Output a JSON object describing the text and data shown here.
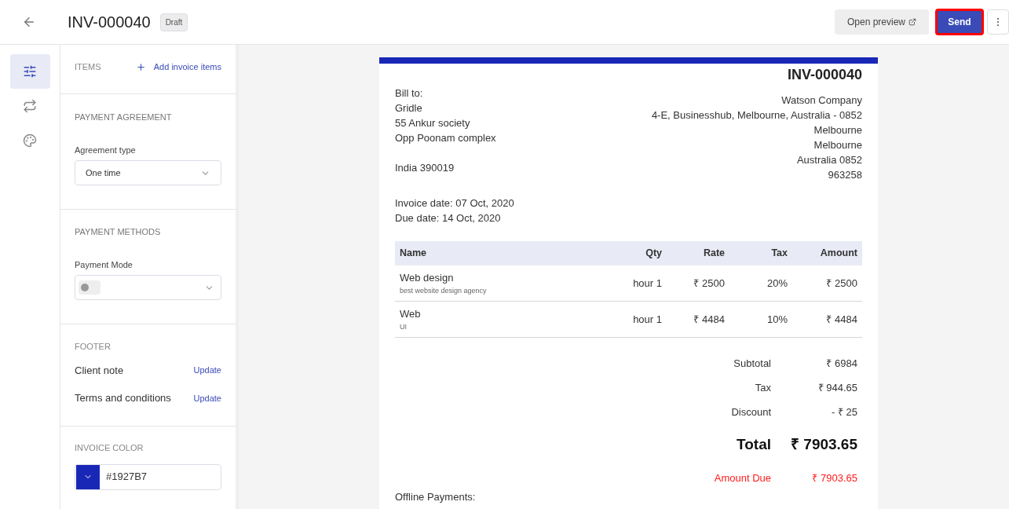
{
  "header": {
    "title": "INV-000040",
    "status": "Draft",
    "preview_button": "Open preview",
    "send_button": {
      "label": "Send",
      "highlighted": true
    }
  },
  "rail": [
    {
      "selected": true
    },
    {
      "selected": false
    },
    {
      "selected": false
    }
  ],
  "panel": {
    "items": {
      "heading": "ITEMS",
      "action": "Add invoice items"
    },
    "payment_agreement": {
      "heading": "PAYMENT AGREEMENT",
      "label": "Agreement type",
      "value": "One time"
    },
    "payment_methods": {
      "heading": "PAYMENT METHODS",
      "label": "Payment Mode",
      "toggle_on": false
    },
    "footer": {
      "heading": "FOOTER",
      "rows": [
        {
          "label": "Client note",
          "action": "Update"
        },
        {
          "label": "Terms and conditions",
          "action": "Update"
        }
      ]
    },
    "invoice_color": {
      "heading": "INVOICE COLOR",
      "value": "#1927B7",
      "color": "#1927b7"
    }
  },
  "invoice": {
    "number": "INV-000040",
    "bill_to_label": "Bill to:",
    "bill_to": [
      "Gridle",
      "55 Ankur society",
      "Opp Poonam complex"
    ],
    "bill_to_country": "India 390019",
    "company": [
      "Watson Company",
      "4-E, Businesshub, Melbourne, Australia - 0852",
      "Melbourne",
      "Melbourne",
      "Australia 0852",
      "963258"
    ],
    "invoice_date": "Invoice date: 07 Oct, 2020",
    "due_date": "Due date: 14 Oct, 2020",
    "columns": [
      "Name",
      "Qty",
      "Rate",
      "Tax",
      "Amount"
    ],
    "rows": [
      {
        "name": "Web design",
        "description": "best website design agency",
        "qty": "hour 1",
        "rate": "₹ 2500",
        "tax": "20%",
        "amount": "₹ 2500"
      },
      {
        "name": "Web",
        "description": "UI",
        "qty": "hour 1",
        "rate": "₹ 4484",
        "tax": "10%",
        "amount": "₹ 4484"
      }
    ],
    "totals": [
      {
        "kind": "plain",
        "label": "Subtotal",
        "value": "₹ 6984"
      },
      {
        "kind": "plain",
        "label": "Tax",
        "value": "₹ 944.65"
      },
      {
        "kind": "plain",
        "label": "Discount",
        "value": "- ₹ 25"
      },
      {
        "kind": "total",
        "label": "Total",
        "value": "₹ 7903.65"
      },
      {
        "kind": "due",
        "label": "Amount Due",
        "value": "₹ 7903.65"
      }
    ],
    "offline_payments": "Offline Payments:"
  }
}
